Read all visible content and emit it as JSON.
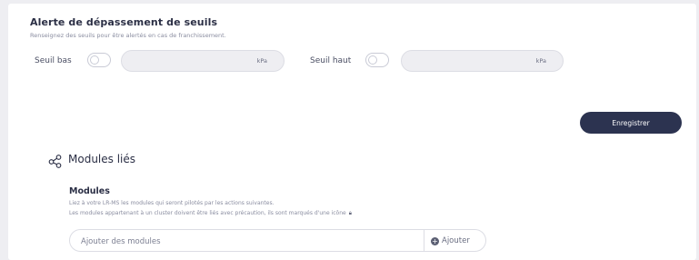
{
  "threshold": {
    "title": "Alerte de dépassement de seuils",
    "subtitle": "Renseignez des seuils pour être alertés en cas de franchissement.",
    "low_label": "Seuil bas",
    "high_label": "Seuil haut",
    "low_unit": "kPa",
    "high_unit": "kPa"
  },
  "save_label": "Enregistrer",
  "modules": {
    "section_title": "Modules liés",
    "subtitle": "Modules",
    "desc_line1": "Liez à votre LR-MS les modules qui seront pilotés par les actions suivantes.",
    "desc_line2": "Les modules appartenant à un cluster doivent être liés avec précaution, ils sont marqués d'une icône",
    "search_placeholder": "Ajouter des modules",
    "add_label": "Ajouter"
  },
  "icons": {
    "section": "share-nodes-icon",
    "lock": "lock-icon",
    "add": "plus-circle-icon"
  }
}
